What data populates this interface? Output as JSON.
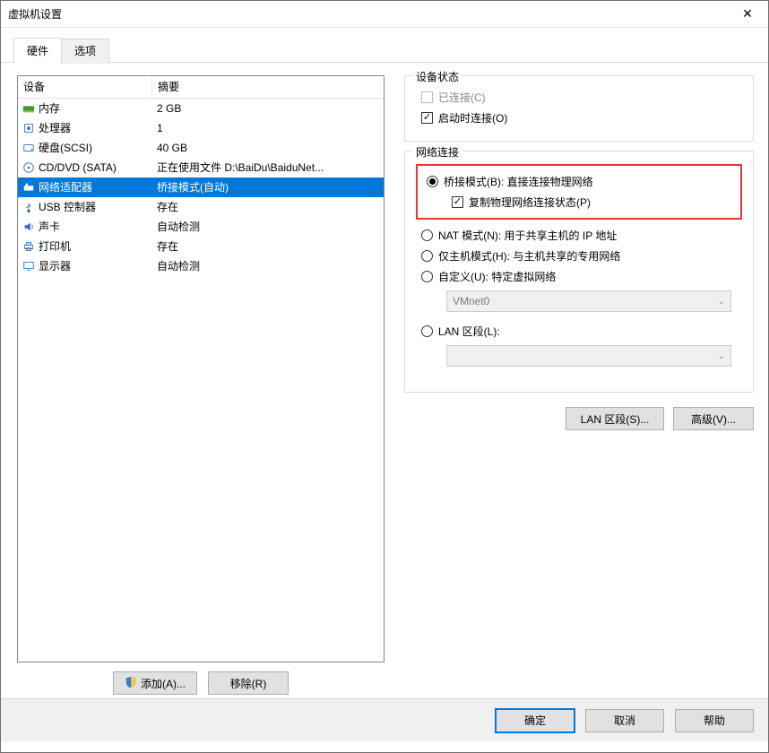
{
  "window": {
    "title": "虚拟机设置",
    "close_glyph": "✕"
  },
  "tabs": {
    "hardware": "硬件",
    "options": "选项"
  },
  "device_table": {
    "col_device": "设备",
    "col_summary": "摘要",
    "rows": [
      {
        "icon": "memory",
        "name": "内存",
        "summary": "2 GB"
      },
      {
        "icon": "cpu",
        "name": "处理器",
        "summary": "1"
      },
      {
        "icon": "hdd",
        "name": "硬盘(SCSI)",
        "summary": "40 GB"
      },
      {
        "icon": "cd",
        "name": "CD/DVD (SATA)",
        "summary": "正在使用文件 D:\\BaiDu\\BaiduNet..."
      },
      {
        "icon": "net",
        "name": "网络适配器",
        "summary": "桥接模式(自动)",
        "selected": true
      },
      {
        "icon": "usb",
        "name": "USB 控制器",
        "summary": "存在"
      },
      {
        "icon": "sound",
        "name": "声卡",
        "summary": "自动检测"
      },
      {
        "icon": "printer",
        "name": "打印机",
        "summary": "存在"
      },
      {
        "icon": "display",
        "name": "显示器",
        "summary": "自动检测"
      }
    ]
  },
  "left_buttons": {
    "add": "添加(A)...",
    "remove": "移除(R)"
  },
  "device_status": {
    "group_title": "设备状态",
    "connected": "已连接(C)",
    "connect_at_poweron": "启动时连接(O)"
  },
  "net_conn": {
    "group_title": "网络连接",
    "bridged": "桥接模式(B): 直接连接物理网络",
    "replicate": "复制物理网络连接状态(P)",
    "nat": "NAT 模式(N): 用于共享主机的 IP 地址",
    "hostonly": "仅主机模式(H): 与主机共享的专用网络",
    "custom": "自定义(U): 特定虚拟网络",
    "custom_value": "VMnet0",
    "lan_segment": "LAN 区段(L):",
    "lan_value": ""
  },
  "right_buttons": {
    "lan_segments": "LAN 区段(S)...",
    "advanced": "高级(V)..."
  },
  "bottom": {
    "ok": "确定",
    "cancel": "取消",
    "help": "帮助"
  },
  "icons": {
    "check_glyph": "✓",
    "chevron_glyph": "⌄"
  }
}
